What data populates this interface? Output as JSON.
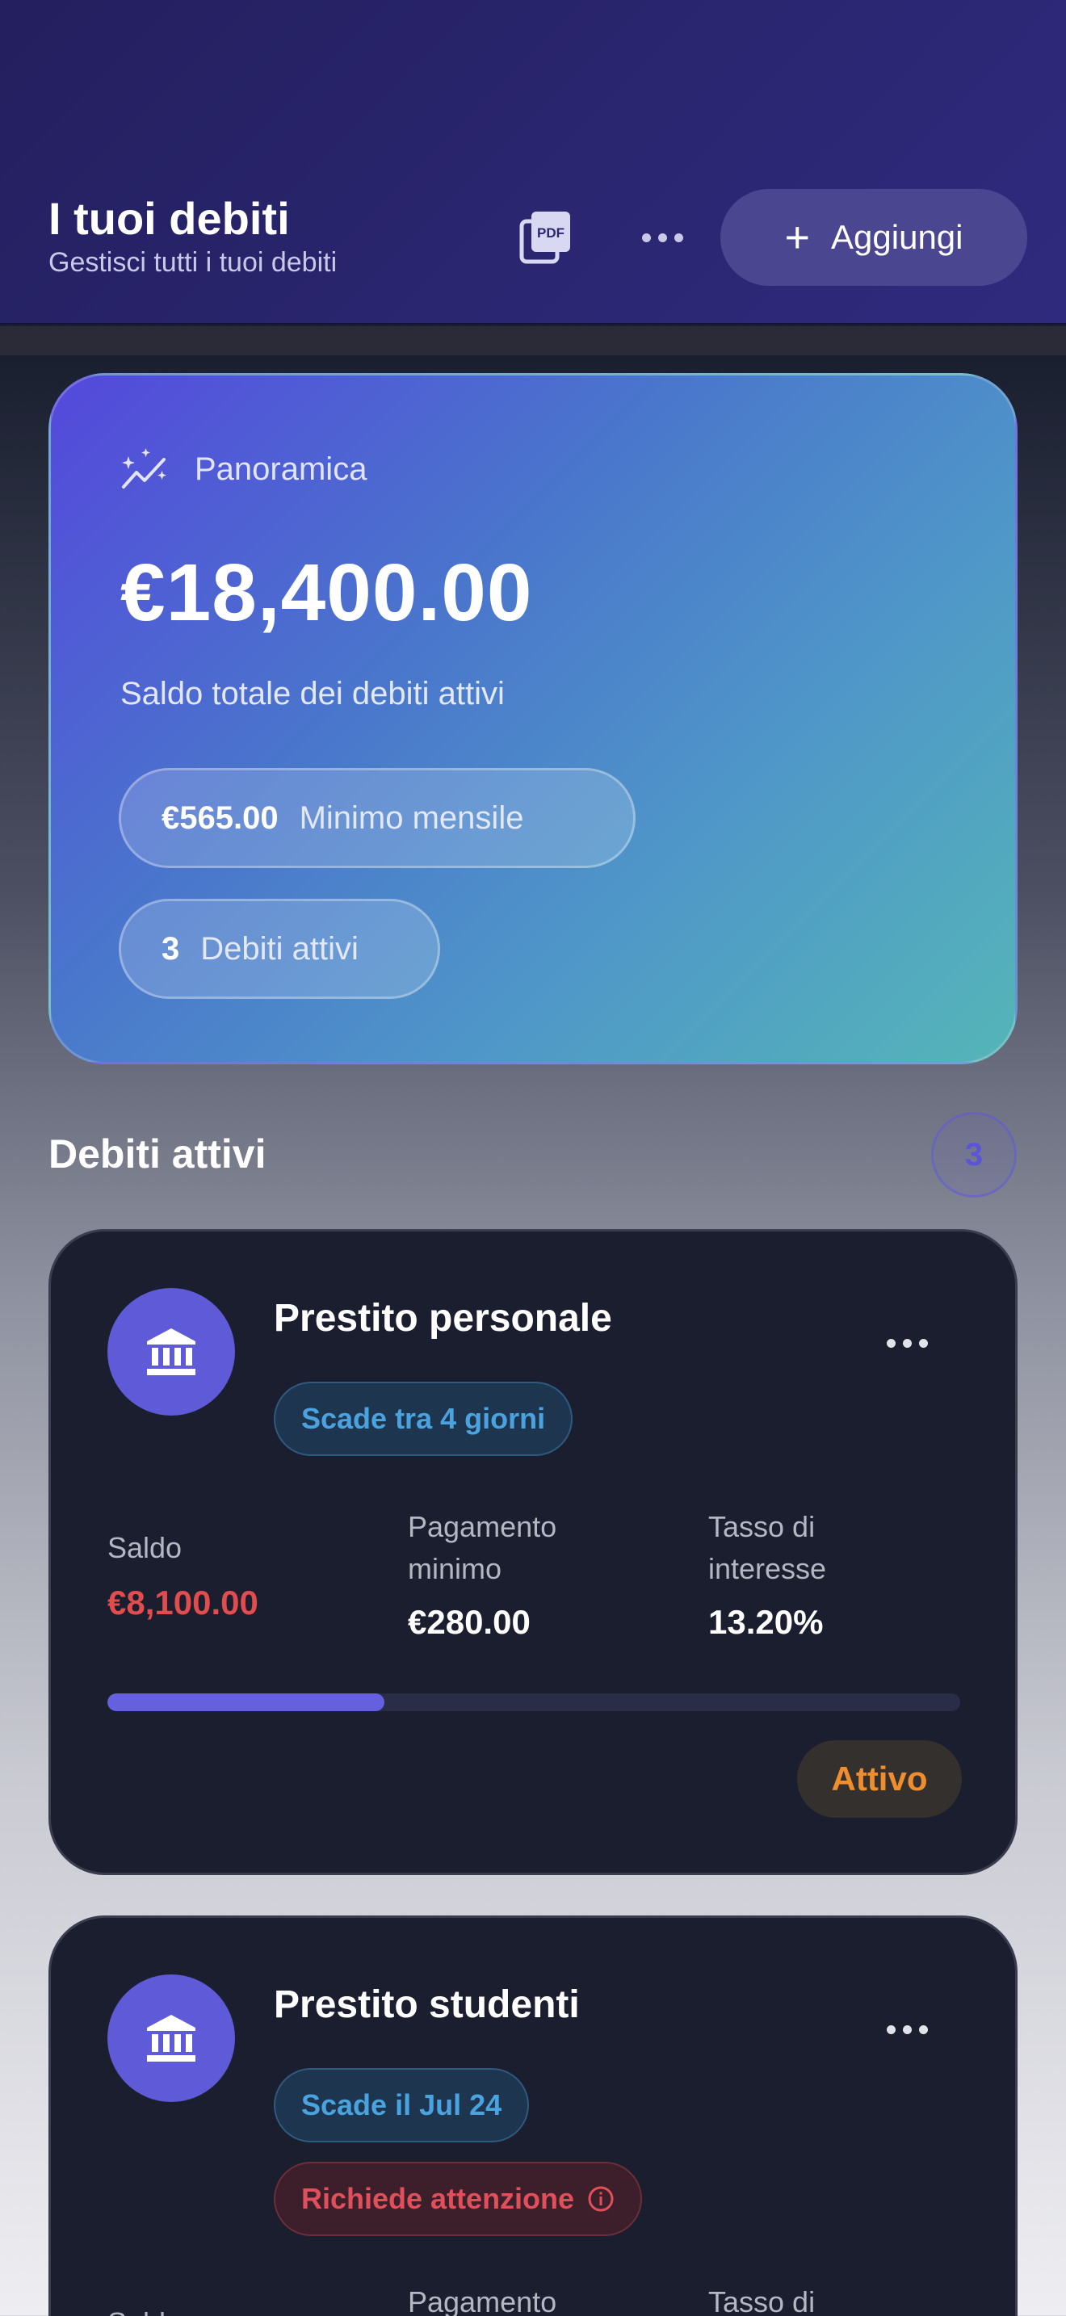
{
  "header": {
    "title": "I tuoi debiti",
    "subtitle": "Gestisci tutti i tuoi debiti",
    "pdf_icon": "pdf-export-icon",
    "more_icon": "ellipsis-icon",
    "add_label": "Aggiungi",
    "add_icon": "plus-icon"
  },
  "overview": {
    "label": "Panoramica",
    "label_icon": "sparkle-chart-icon",
    "total": "€18,400.00",
    "description": "Saldo totale dei debiti attivi",
    "monthly_min_value": "€565.00",
    "monthly_min_label": "Minimo mensile",
    "active_count_value": "3",
    "active_count_label": "Debiti attivi"
  },
  "section": {
    "title": "Debiti attivi",
    "count": "3"
  },
  "debts": [
    {
      "name": "Prestito personale",
      "icon": "bank-icon",
      "due_tag": "Scade tra 4 giorni",
      "balance_label": "Saldo",
      "balance": "€8,100.00",
      "min_payment_label": "Pagamento minimo",
      "min_payment": "€280.00",
      "rate_label": "Tasso di interesse",
      "rate": "13.20%",
      "progress": 0.325,
      "status": "Attivo"
    },
    {
      "name": "Prestito studenti",
      "icon": "bank-icon",
      "due_tag": "Scade il Jul 24",
      "warning_tag": "Richiede attenzione",
      "warning_icon": "info-icon",
      "balance_label": "Saldo",
      "min_payment_label": "Pagamento",
      "rate_label": "Tasso di"
    }
  ],
  "colors": {
    "accent": "#5e5ad8",
    "danger": "#e14d4d",
    "info": "#4aa3de",
    "warning": "#f08e2e"
  }
}
